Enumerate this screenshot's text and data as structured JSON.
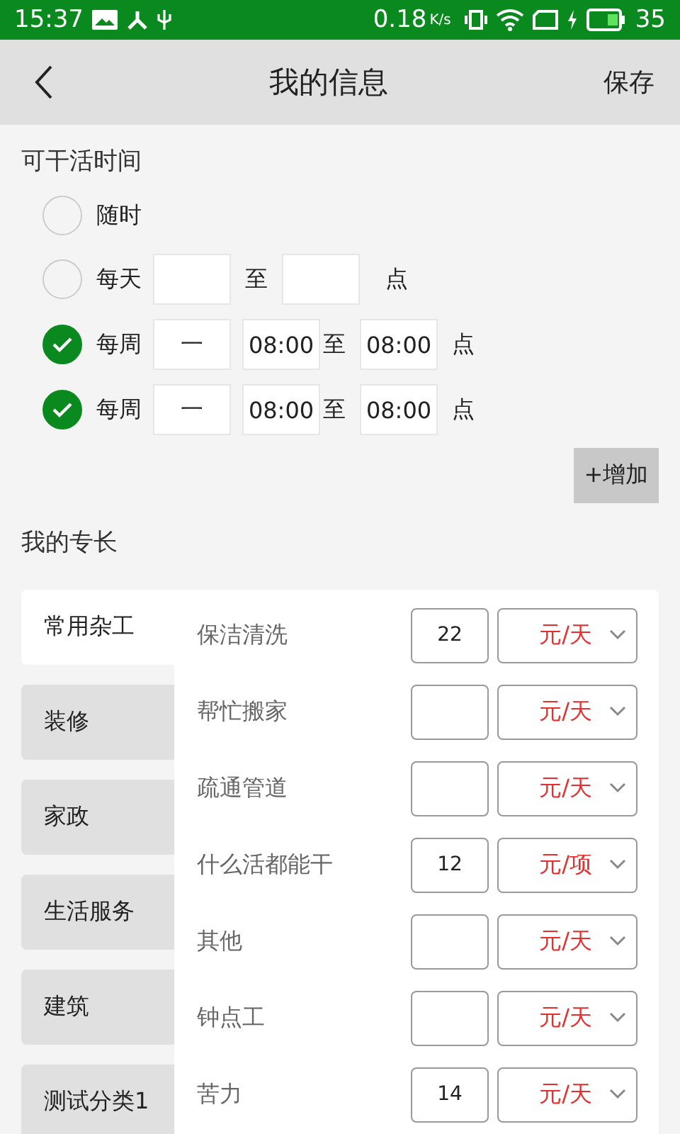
{
  "status_bar": {
    "time": "15:37",
    "speed": "0.18",
    "speed_unit": "K/s",
    "battery": "35"
  },
  "header": {
    "title": "我的信息",
    "action": "保存"
  },
  "availability": {
    "title": "可干活时间",
    "options": [
      {
        "kind": "anytime",
        "label": "随时",
        "checked": false
      },
      {
        "kind": "daily",
        "label": "每天",
        "separator": "至",
        "unit": "点",
        "checked": false
      },
      {
        "kind": "weekly",
        "label": "每周",
        "day": "一",
        "from": "08:00",
        "separator": "至",
        "to": "08:00",
        "unit": "点",
        "checked": true
      },
      {
        "kind": "weekly",
        "label": "每周",
        "day": "一",
        "from": "08:00",
        "separator": "至",
        "to": "08:00",
        "unit": "点",
        "checked": true
      }
    ],
    "add_button": "+增加"
  },
  "skills": {
    "title": "我的专长",
    "categories": [
      {
        "label": "常用杂工",
        "selected": true
      },
      {
        "label": "装修",
        "selected": false
      },
      {
        "label": "家政",
        "selected": false
      },
      {
        "label": "生活服务",
        "selected": false
      },
      {
        "label": "建筑",
        "selected": false
      },
      {
        "label": "测试分类1",
        "selected": false
      }
    ],
    "items": [
      {
        "name": "保洁清洗",
        "price": "22",
        "unit": "元/天"
      },
      {
        "name": "帮忙搬家",
        "unit": "元/天"
      },
      {
        "name": "疏通管道",
        "unit": "元/天"
      },
      {
        "name": "什么活都能干",
        "price": "12",
        "unit": "元/项"
      },
      {
        "name": "其他",
        "unit": "元/天"
      },
      {
        "name": "钟点工",
        "unit": "元/天"
      },
      {
        "name": "苦力",
        "price": "14",
        "unit": "元/天"
      }
    ]
  }
}
